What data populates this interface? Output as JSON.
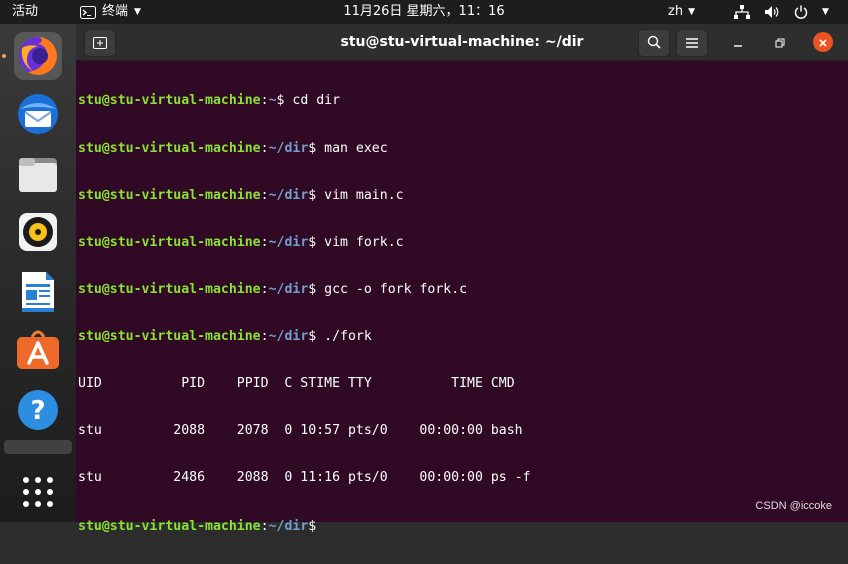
{
  "topbar": {
    "activities": "活动",
    "app_name": "终端",
    "clock": "11月26日 星期六，11：16",
    "lang": "zh",
    "icons": [
      "terminal-icon",
      "network-icon",
      "volume-icon",
      "power-icon"
    ]
  },
  "dock": {
    "apps": [
      "firefox",
      "thunderbird",
      "files",
      "rhythmbox",
      "libreoffice-writer",
      "ubuntu-software",
      "help",
      "show-applications"
    ]
  },
  "terminal": {
    "title": "stu@stu-virtual-machine: ~/dir",
    "bg_color": "#300a24",
    "prompt_user": "stu@stu-virtual-machine",
    "lines": [
      {
        "path": "~",
        "cmd": "cd dir"
      },
      {
        "path": "~/dir",
        "cmd": "man exec"
      },
      {
        "path": "~/dir",
        "cmd": "vim main.c"
      },
      {
        "path": "~/dir",
        "cmd": "vim fork.c"
      },
      {
        "path": "~/dir",
        "cmd": "gcc -o fork fork.c"
      },
      {
        "path": "~/dir",
        "cmd": "./fork"
      }
    ],
    "ps_header": "UID          PID    PPID  C STIME TTY          TIME CMD",
    "ps_rows": [
      "stu         2088    2078  0 10:57 pts/0    00:00:00 bash",
      "stu         2486    2088  0 11:16 pts/0    00:00:00 ps -f"
    ],
    "final_prompt_path": "~/dir"
  },
  "watermark": "CSDN @iccoke"
}
